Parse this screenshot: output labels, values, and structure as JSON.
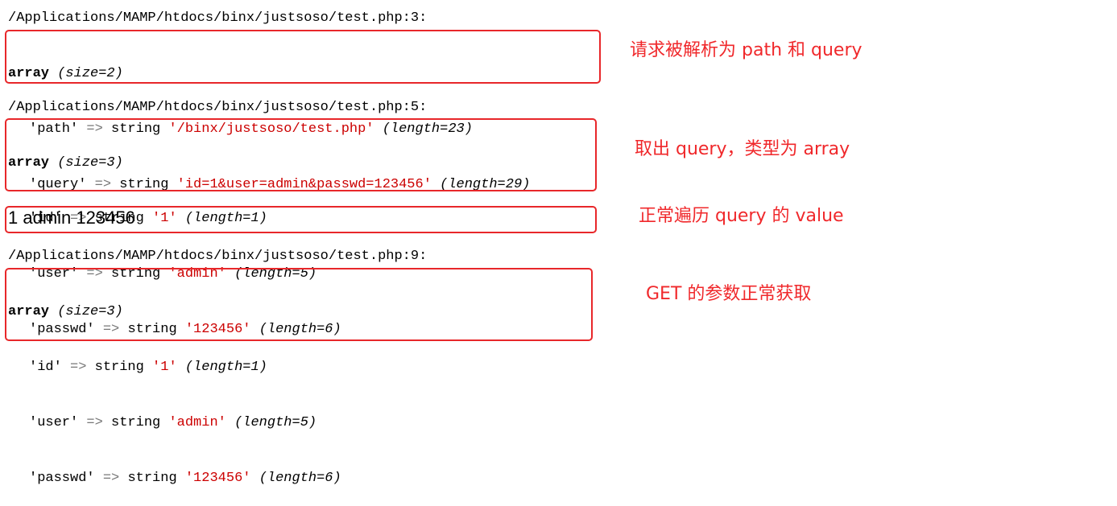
{
  "colors": {
    "annotation_red": "#e8272a",
    "string_red": "#cc0000",
    "arrow_gray": "#777777"
  },
  "dumps": [
    {
      "path": "/Applications/MAMP/htdocs/binx/justsoso/test.php:3:",
      "header_kw": "array",
      "header_size": "(size=2)",
      "rows": [
        {
          "key": "'path'",
          "arrow": "=>",
          "type": "string",
          "value": "'/binx/justsoso/test.php'",
          "len": "(length=23)"
        },
        {
          "key": "'query'",
          "arrow": "=>",
          "type": "string",
          "value": "'id=1&user=admin&passwd=123456'",
          "len": "(length=29)"
        }
      ]
    },
    {
      "path": "/Applications/MAMP/htdocs/binx/justsoso/test.php:5:",
      "header_kw": "array",
      "header_size": "(size=3)",
      "rows": [
        {
          "key": "'id'",
          "arrow": "=>",
          "type": "string",
          "value": "'1'",
          "len": "(length=1)"
        },
        {
          "key": "'user'",
          "arrow": "=>",
          "type": "string",
          "value": "'admin'",
          "len": "(length=5)"
        },
        {
          "key": "'passwd'",
          "arrow": "=>",
          "type": "string",
          "value": "'123456'",
          "len": "(length=6)"
        }
      ]
    },
    {
      "path": "/Applications/MAMP/htdocs/binx/justsoso/test.php:9:",
      "header_kw": "array",
      "header_size": "(size=3)",
      "rows": [
        {
          "key": "'id'",
          "arrow": "=>",
          "type": "string",
          "value": "'1'",
          "len": "(length=1)"
        },
        {
          "key": "'user'",
          "arrow": "=>",
          "type": "string",
          "value": "'admin'",
          "len": "(length=5)"
        },
        {
          "key": "'passwd'",
          "arrow": "=>",
          "type": "string",
          "value": "'123456'",
          "len": "(length=6)"
        }
      ]
    }
  ],
  "plain_output": "1 admin 123456",
  "annotations": [
    "请求被解析为 path 和 query",
    "取出 query，类型为 array",
    "正常遍历 query 的 value",
    "GET 的参数正常获取"
  ]
}
